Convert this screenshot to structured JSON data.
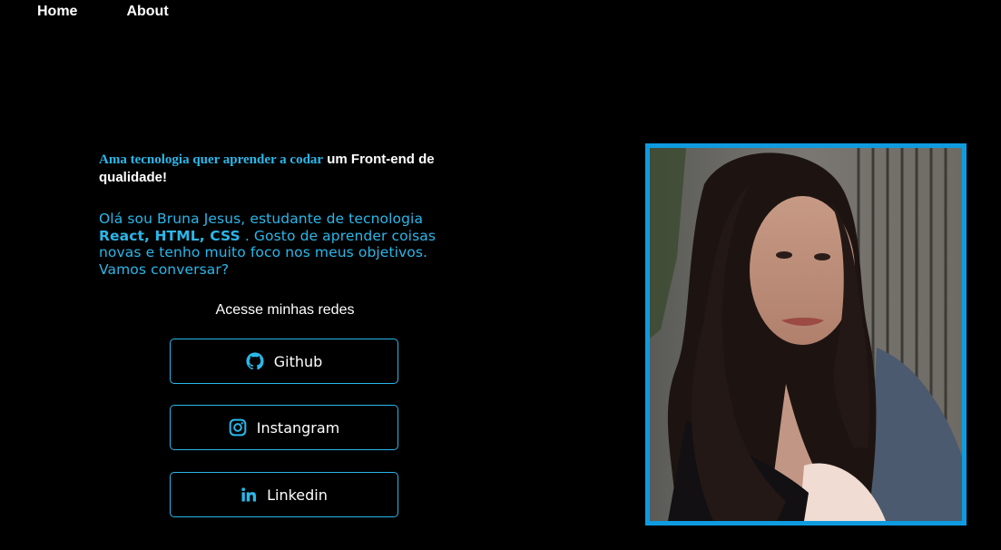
{
  "nav": {
    "items": [
      {
        "label": "Home"
      },
      {
        "label": "About"
      }
    ]
  },
  "hero": {
    "headline_accent": "Ama tecnologia quer aprender a codar",
    "headline_rest": "um Front-end de qualidade!",
    "intro_part1": "Olá sou Bruna Jesus, estudante de tecnologia",
    "intro_strong": "React, HTML, CSS",
    "intro_part2": ". Gosto de aprender coisas novas e tenho muito foco nos meus objetivos. Vamos conversar?"
  },
  "social": {
    "title": "Acesse minhas redes",
    "links": [
      {
        "label": "Github",
        "icon": "github-icon"
      },
      {
        "label": "Instangram",
        "icon": "instagram-icon"
      },
      {
        "label": "Linkedin",
        "icon": "linkedin-icon"
      }
    ]
  },
  "colors": {
    "accent": "#2ab7ea",
    "frame": "#0f9be0",
    "background": "#000000"
  }
}
